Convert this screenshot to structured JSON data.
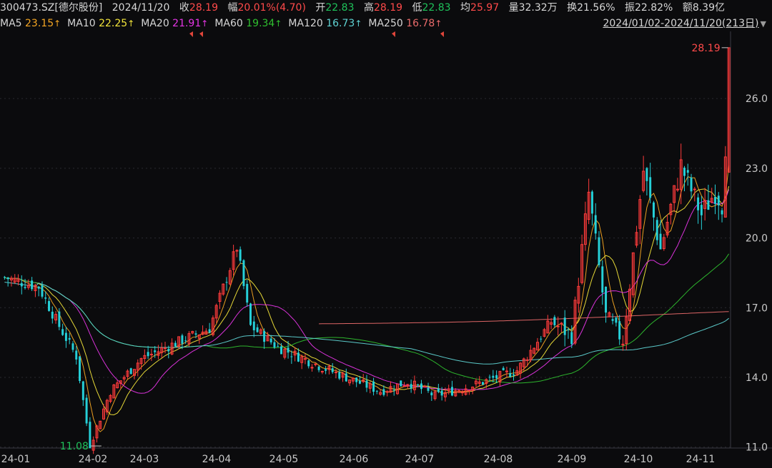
{
  "header": {
    "code": "300473.SZ[德尔股份]",
    "date": "2024/11/20",
    "close": {
      "label": "收",
      "value": "28.19"
    },
    "change": {
      "label": "幅",
      "value": "20.01%(4.70)"
    },
    "open": {
      "label": "开",
      "value": "22.83"
    },
    "high": {
      "label": "高",
      "value": "28.19"
    },
    "low": {
      "label": "低",
      "value": "22.83"
    },
    "avg": {
      "label": "均",
      "value": "25.97"
    },
    "volume": {
      "label": "量",
      "value": "32.32万"
    },
    "turnover": {
      "label": "换",
      "value": "21.56%"
    },
    "amplitude": {
      "label": "振",
      "value": "22.82%"
    },
    "amount": {
      "label": "额",
      "value": "8.39亿"
    }
  },
  "ma_legend": [
    {
      "label": "MA5",
      "value": "23.15",
      "arrow": "↑",
      "color": "#f5a623"
    },
    {
      "label": "MA10",
      "value": "22.25",
      "arrow": "↑",
      "color": "#f2e43a"
    },
    {
      "label": "MA20",
      "value": "21.91",
      "arrow": "↑",
      "color": "#e535e5"
    },
    {
      "label": "MA60",
      "value": "19.34",
      "arrow": "↑",
      "color": "#2fbf2f"
    },
    {
      "label": "MA120",
      "value": "16.73",
      "arrow": "↑",
      "color": "#5fd3d3"
    },
    {
      "label": "MA250",
      "value": "16.78",
      "arrow": "↑",
      "color": "#e86a6a"
    }
  ],
  "range_label": "2024/01/02-2024/11/20(213日)",
  "colors": {
    "up": "#ff3b3b",
    "down": "#26d0d8",
    "bg": "#0b0b0d",
    "grid": "#2a2a30"
  },
  "chart_data": {
    "type": "candlestick",
    "x_labels": [
      "24-01",
      "24-02",
      "24-03",
      "24-04",
      "24-05",
      "24-06",
      "24-07",
      "24-08",
      "24-09",
      "24-10",
      "24-11"
    ],
    "y_ticks": [
      11.0,
      14.0,
      17.0,
      20.0,
      23.0,
      26.0
    ],
    "y_tick_labels": [
      "11.0",
      "14.0",
      "17.0",
      "20.0",
      "23.0",
      "26.0"
    ],
    "ylim": [
      10.96,
      28.4
    ],
    "max_annotation": "28.19",
    "min_annotation": "11.08",
    "key_prices": [
      18.3,
      17.9,
      16.2,
      14.9,
      11.08,
      13.4,
      14.8,
      15.6,
      16.1,
      19.6,
      16.2,
      15.3,
      14.3,
      13.4,
      13.8,
      13.2,
      13.7,
      14.3,
      16.4,
      15.8,
      21.9,
      16.6,
      15.6,
      22.9,
      19.5,
      23.1,
      21.0,
      22.0,
      21.2,
      22.7,
      28.19
    ],
    "key_days": [
      0,
      10,
      16,
      21,
      25,
      31,
      40,
      52,
      60,
      68,
      72,
      80,
      95,
      110,
      118,
      126,
      138,
      150,
      160,
      166,
      171,
      176,
      181,
      187,
      192,
      198,
      204,
      208,
      211,
      212,
      212
    ],
    "n_days": 213,
    "ma_series": [
      "MA5",
      "MA10",
      "MA20",
      "MA60",
      "MA120",
      "MA250"
    ]
  }
}
